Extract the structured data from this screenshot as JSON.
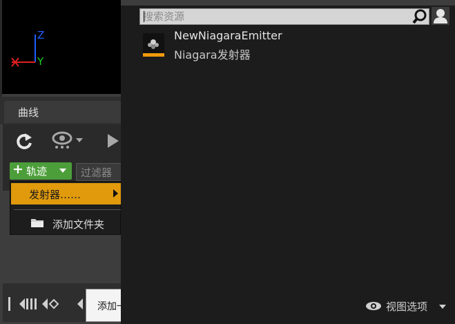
{
  "viewport": {
    "axis_z": "Z",
    "axis_y": "Y",
    "axis_x_color": "#e02020",
    "axis_y_color": "#20d020",
    "axis_z_color": "#2060ff"
  },
  "curves_tab": {
    "label": "曲线"
  },
  "toolbar": {
    "icons": [
      "refresh-icon",
      "eye-icon",
      "play-icon"
    ],
    "track_button": {
      "label": "轨迹",
      "icon": "plus-icon",
      "color": "#4c9e3a"
    },
    "filter_button": {
      "label": "过滤器"
    }
  },
  "menu": {
    "items": [
      {
        "label": "发射器……",
        "has_submenu": true,
        "highlighted": true,
        "highlight_color": "#e09a0c"
      },
      {
        "label": "添加文件夹",
        "icon": "folder-icon"
      }
    ]
  },
  "tooltip": {
    "text": "添加一个现有的发射器……"
  },
  "asset_picker": {
    "search": {
      "placeholder": "搜索资源",
      "value": ""
    },
    "assets": [
      {
        "name": "NewNiagaraEmitter",
        "type": "Niagara发射器",
        "thumbnail_accent": "#f09a0c"
      }
    ],
    "view_options_label": "视图选项"
  }
}
